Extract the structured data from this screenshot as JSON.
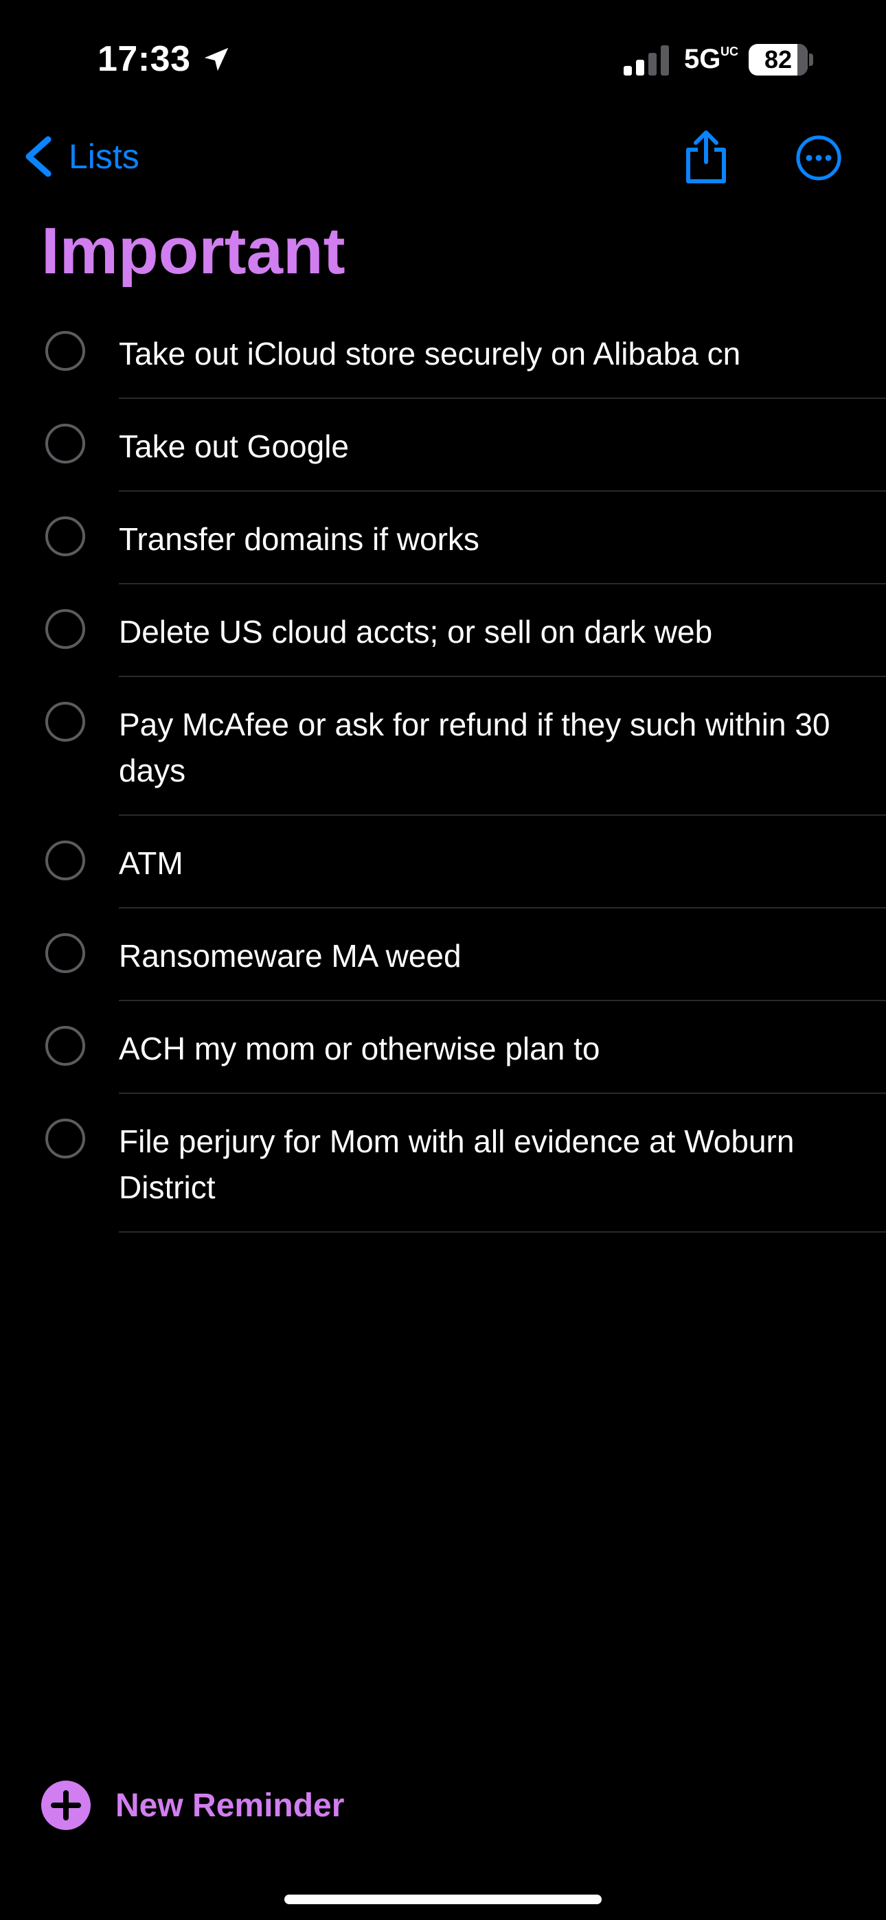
{
  "status_bar": {
    "time": "17:33",
    "network": "5G",
    "network_sup": "UC",
    "battery_percent": "82",
    "battery_level": 0.82,
    "signal_bars_active": 2,
    "signal_bars_total": 4
  },
  "nav": {
    "back_label": "Lists",
    "accent_color": "#0a84ff"
  },
  "list": {
    "title": "Important",
    "color": "#d17ef0",
    "items": [
      {
        "text": "Take out iCloud store securely on Alibaba cn",
        "completed": false
      },
      {
        "text": "Take out Google",
        "completed": false
      },
      {
        "text": "Transfer domains if works",
        "completed": false
      },
      {
        "text": "Delete US cloud accts; or sell on dark web",
        "completed": false
      },
      {
        "text": "Pay McAfee or ask for refund if they such within 30 days",
        "completed": false
      },
      {
        "text": "ATM",
        "completed": false
      },
      {
        "text": "Ransomeware MA weed",
        "completed": false
      },
      {
        "text": "ACH my mom or otherwise plan to",
        "completed": false
      },
      {
        "text": "File perjury for Mom with all evidence at Woburn District",
        "completed": false
      }
    ]
  },
  "footer": {
    "new_reminder_label": "New Reminder"
  }
}
